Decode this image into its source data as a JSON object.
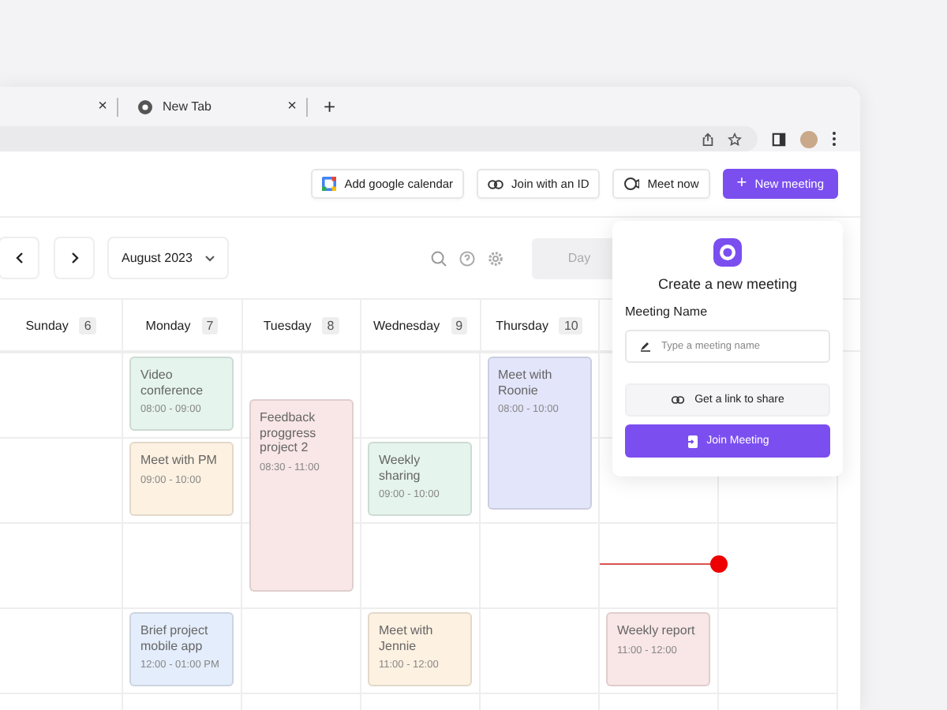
{
  "browser": {
    "tabs": [
      {
        "label": "New Tab"
      }
    ],
    "close_glyph": "×",
    "new_tab_glyph": "+"
  },
  "header_actions": [
    {
      "kind": "google",
      "label": "Add google calendar"
    },
    {
      "kind": "link",
      "label": "Join with an ID"
    },
    {
      "kind": "meet",
      "label": "Meet now"
    },
    {
      "kind": "primary",
      "label": "New meeting",
      "glyph": "+"
    }
  ],
  "toolbar": {
    "month": "August 2023",
    "view": "Day"
  },
  "columns": [
    {
      "name": "Sunday",
      "date": "6"
    },
    {
      "name": "Monday",
      "date": "7",
      "events": [
        {
          "title": "Video conference",
          "time": "08:00 - 09:00",
          "color": "#e5f4ed"
        },
        {
          "title": "Meet with PM",
          "time": "09:00 - 10:00",
          "color": "#fdf1e1"
        },
        {
          "title": "Brief project mobile app",
          "time": "12:00 - 01:00 PM",
          "color": "#e4edfb"
        }
      ]
    },
    {
      "name": "Tuesday",
      "date": "8",
      "events": [
        {
          "title": "Feedback proggress project 2",
          "time": "08:30 - 11:00",
          "color": "#f9e6e6"
        }
      ]
    },
    {
      "name": "Wednesday",
      "date": "9",
      "events": [
        {
          "title": "Weekly sharing",
          "time": "09:00 - 10:00",
          "color": "#e5f4ed"
        },
        {
          "title": "Meet with Jennie",
          "time": "11:00 - 12:00",
          "color": "#fdf1e1"
        }
      ]
    },
    {
      "name": "Thursday",
      "date": "10",
      "events": [
        {
          "title": "Meet with Roonie",
          "time": "08:00 - 10:00",
          "color": "#e3e5fa"
        }
      ]
    },
    {
      "events": [
        {
          "title": "Weekly report",
          "time": "11:00 - 12:00",
          "color": "#f9e6e6"
        }
      ]
    }
  ],
  "now_line": true,
  "popup": {
    "title": "Create a new meeting",
    "field_label": "Meeting Name",
    "placeholder": "Type a meeting name",
    "link_button": "Get a link to share",
    "join_button": "Join Meeting"
  }
}
